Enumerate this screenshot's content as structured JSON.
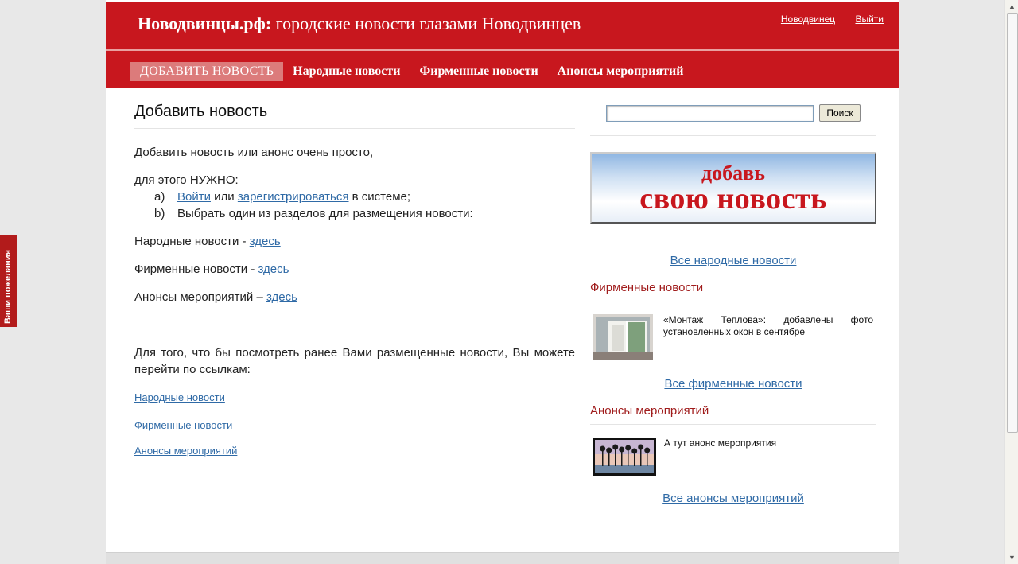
{
  "header": {
    "site_name": "Новодвинцы.рф:",
    "tagline": "городские новости глазами Новодвинцев",
    "user_link": "Новодвинец",
    "logout_link": "Выйти"
  },
  "nav": {
    "items": [
      {
        "label": "ДОБАВИТЬ НОВОСТЬ"
      },
      {
        "label": "Народные новости"
      },
      {
        "label": "Фирменные новости"
      },
      {
        "label": "Анонсы мероприятий"
      }
    ]
  },
  "main": {
    "title": "Добавить новость",
    "intro": "Добавить новость или анонс очень просто,",
    "need": "для этого НУЖНО:",
    "step_a_mark": "a)",
    "step_a_login": "Войти",
    "step_a_or": "или",
    "step_a_register": "зарегистрироваться",
    "step_a_rest": "в системе;",
    "step_b_mark": "b)",
    "step_b_text": "Выбрать один из разделов для размещения новости:",
    "section_lines": [
      {
        "label": "Народные новости -",
        "link": "здесь"
      },
      {
        "label": "Фирменные новости -",
        "link": "здесь"
      },
      {
        "label": "Анонсы мероприятий –",
        "link": "здесь"
      }
    ],
    "previous_text": "Для того, что бы посмотреть ранее Вами размещенные новости, Вы можете перейти по ссылкам:",
    "links": [
      "Народные новости",
      "Фирменные новости",
      "Анонсы мероприятий"
    ]
  },
  "sidebar": {
    "search_placeholder": "",
    "search_button": "Поиск",
    "banner_line1": "добавь",
    "banner_line2": "свою новость",
    "all_people_news": "Все народные новости",
    "company_title": "Фирменные новости",
    "company_item": "«Монтаж Теплова»: добавлены фото установленных окон в сентябре",
    "all_company_news": "Все фирменные новости",
    "events_title": "Анонсы мероприятий",
    "events_item": "А тут анонс мероприятия",
    "all_events": "Все анонсы мероприятий"
  },
  "feedback_tab": "Ваши пожелания"
}
